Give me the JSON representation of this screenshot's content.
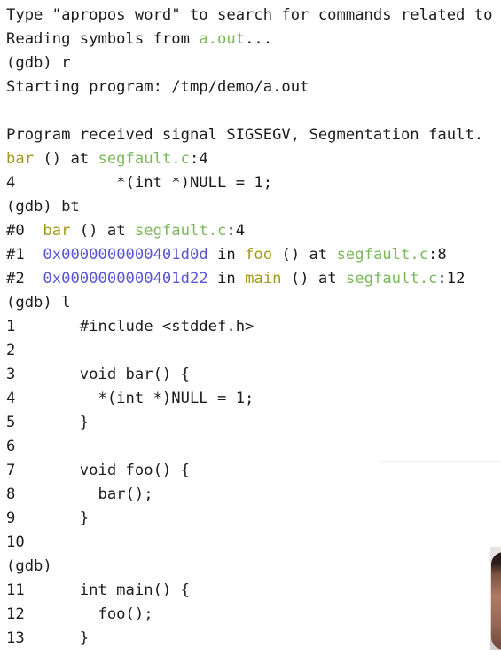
{
  "terminal": {
    "top_partial": "",
    "lines": [
      {
        "segments": [
          {
            "text": "Type \"apropos word\" to search for commands related to",
            "color": "def"
          }
        ]
      },
      {
        "segments": [
          {
            "text": "Reading symbols from ",
            "color": "def"
          },
          {
            "text": "a.out",
            "color": "green"
          },
          {
            "text": "...",
            "color": "def"
          }
        ]
      },
      {
        "segments": [
          {
            "text": "(gdb) r",
            "color": "def"
          }
        ]
      },
      {
        "segments": [
          {
            "text": "Starting program: /tmp/demo/a.out",
            "color": "def"
          }
        ]
      },
      {
        "segments": [
          {
            "text": "",
            "color": "def"
          }
        ]
      },
      {
        "segments": [
          {
            "text": "Program received signal SIGSEGV, Segmentation fault.",
            "color": "def"
          }
        ]
      },
      {
        "segments": [
          {
            "text": "bar",
            "color": "olive"
          },
          {
            "text": " () at ",
            "color": "def"
          },
          {
            "text": "segfault.c",
            "color": "green"
          },
          {
            "text": ":4",
            "color": "def"
          }
        ]
      },
      {
        "segments": [
          {
            "text": "4           *(int *)NULL = 1;",
            "color": "def"
          }
        ]
      },
      {
        "segments": [
          {
            "text": "(gdb) bt",
            "color": "def"
          }
        ]
      },
      {
        "segments": [
          {
            "text": "#0  ",
            "color": "def"
          },
          {
            "text": "bar",
            "color": "olive"
          },
          {
            "text": " () at ",
            "color": "def"
          },
          {
            "text": "segfault.c",
            "color": "green"
          },
          {
            "text": ":4",
            "color": "def"
          }
        ]
      },
      {
        "segments": [
          {
            "text": "#1  ",
            "color": "def"
          },
          {
            "text": "0x0000000000401d0d",
            "color": "blue"
          },
          {
            "text": " in ",
            "color": "def"
          },
          {
            "text": "foo",
            "color": "olive"
          },
          {
            "text": " () at ",
            "color": "def"
          },
          {
            "text": "segfault.c",
            "color": "green"
          },
          {
            "text": ":8",
            "color": "def"
          }
        ]
      },
      {
        "segments": [
          {
            "text": "#2  ",
            "color": "def"
          },
          {
            "text": "0x0000000000401d22",
            "color": "blue"
          },
          {
            "text": " in ",
            "color": "def"
          },
          {
            "text": "main",
            "color": "olive"
          },
          {
            "text": " () at ",
            "color": "def"
          },
          {
            "text": "segfault.c",
            "color": "green"
          },
          {
            "text": ":12",
            "color": "def"
          }
        ]
      },
      {
        "segments": [
          {
            "text": "(gdb) l",
            "color": "def"
          }
        ]
      },
      {
        "segments": [
          {
            "text": "1       #include <stddef.h>",
            "color": "def"
          }
        ]
      },
      {
        "segments": [
          {
            "text": "2",
            "color": "def"
          }
        ]
      },
      {
        "segments": [
          {
            "text": "3       void bar() {",
            "color": "def"
          }
        ]
      },
      {
        "segments": [
          {
            "text": "4         *(int *)NULL = 1;",
            "color": "def"
          }
        ]
      },
      {
        "segments": [
          {
            "text": "5       }",
            "color": "def"
          }
        ]
      },
      {
        "segments": [
          {
            "text": "6",
            "color": "def"
          }
        ]
      },
      {
        "segments": [
          {
            "text": "7       void foo() {",
            "color": "def"
          }
        ]
      },
      {
        "segments": [
          {
            "text": "8         bar();",
            "color": "def"
          }
        ]
      },
      {
        "segments": [
          {
            "text": "9       }",
            "color": "def"
          }
        ]
      },
      {
        "segments": [
          {
            "text": "10",
            "color": "def"
          }
        ]
      },
      {
        "segments": [
          {
            "text": "(gdb)",
            "color": "def"
          }
        ]
      },
      {
        "segments": [
          {
            "text": "11      int main() {",
            "color": "def"
          }
        ]
      },
      {
        "segments": [
          {
            "text": "12        foo();",
            "color": "def"
          }
        ]
      },
      {
        "segments": [
          {
            "text": "13      }",
            "color": "def"
          }
        ]
      }
    ]
  },
  "colors": {
    "background": "#ffffff",
    "text": "#1c1c1c",
    "function_name": "#a39a1a",
    "file_name": "#7ab85a",
    "address": "#5856d6"
  }
}
